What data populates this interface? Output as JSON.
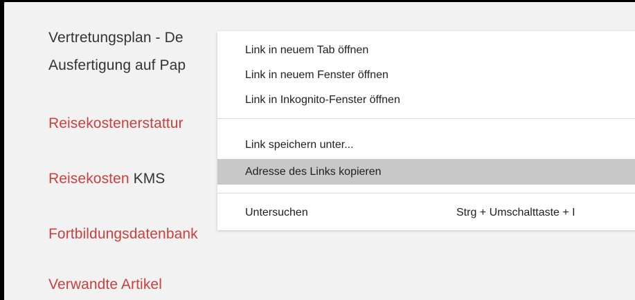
{
  "page": {
    "line1_text": "Vertretungsplan - De",
    "line2_text": "Ausfertigung auf Pap",
    "link_reisekostenerstattung": "Reisekostenerstattur",
    "link_reisekosten": "Reisekosten",
    "reisekosten_suffix": " KMS",
    "link_fortbildungsdatenbank": "Fortbildungsdatenbank",
    "link_verwandte_artikel": "Verwandte Artikel"
  },
  "context_menu": {
    "items": [
      {
        "label": "Link in neuem Tab öffnen"
      },
      {
        "label": "Link in neuem Fenster öffnen"
      },
      {
        "label": "Link in Inkognito-Fenster öffnen"
      },
      {
        "label": "Link speichern unter..."
      },
      {
        "label": "Adresse des Links kopieren",
        "highlighted": true
      },
      {
        "label": "Untersuchen",
        "shortcut": "Strg + Umschalttaste + I"
      }
    ]
  },
  "colors": {
    "link": "#c9403f",
    "text": "#333333",
    "menu_highlight": "#c8c8c8",
    "page_background": "#f2f2f2"
  }
}
